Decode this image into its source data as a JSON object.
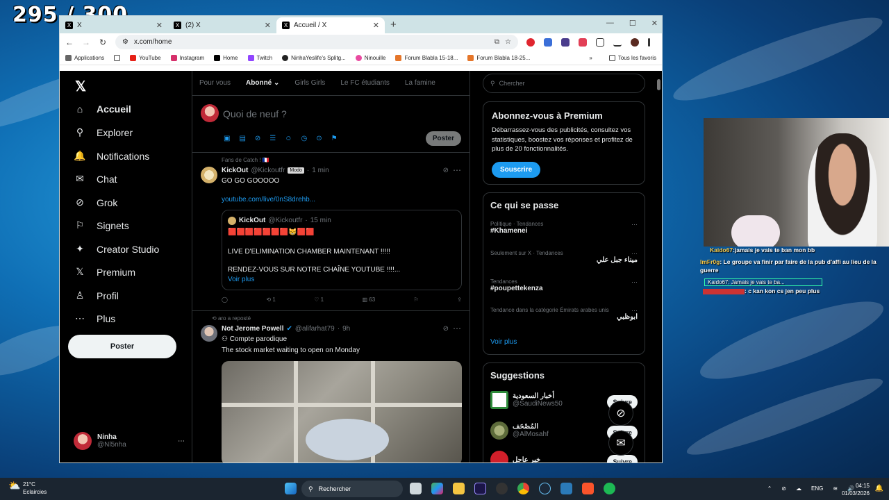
{
  "overlay": {
    "counter": "295 / 300",
    "chat": [
      {
        "name": "Kaido67",
        "text": ":jamais je vais te ban mon bb"
      },
      {
        "name": "ImFr0g",
        "text": ": Le groupe va finir par faire de la pub d'affi au lieu de la"
      },
      {
        "name": "",
        "text": "guerre"
      },
      {
        "name": "",
        "text": "Kaido67: Jamais je vais te ba..."
      },
      {
        "name": "",
        "text": ": c kan kon cs jen peu plus"
      }
    ]
  },
  "browser": {
    "tabs": [
      {
        "label": "X",
        "active": false
      },
      {
        "label": "(2) X",
        "active": false
      },
      {
        "label": "Accueil / X",
        "active": true
      }
    ],
    "url": "x.com/home",
    "bookmarks": [
      "Applications",
      "YouTube",
      "Instagram",
      "Home",
      "Twitch",
      "NinhaYeslife's Splitg...",
      "Ninouille",
      "Forum Blabla 15-18...",
      "Forum Blabla 18-25..."
    ],
    "bookmarks_more": "»",
    "all_favorites": "Tous les favoris"
  },
  "x": {
    "nav": [
      {
        "label": "Accueil",
        "icon": "home-icon",
        "glyph": "⌂"
      },
      {
        "label": "Explorer",
        "icon": "search-icon",
        "glyph": "⚲"
      },
      {
        "label": "Notifications",
        "icon": "bell-icon",
        "glyph": "🔔"
      },
      {
        "label": "Chat",
        "icon": "mail-icon",
        "glyph": "✉"
      },
      {
        "label": "Grok",
        "icon": "grok-icon",
        "glyph": "⊘"
      },
      {
        "label": "Signets",
        "icon": "bookmark-icon",
        "glyph": "⚐"
      },
      {
        "label": "Creator Studio",
        "icon": "creator-icon",
        "glyph": "✦"
      },
      {
        "label": "Premium",
        "icon": "x-icon",
        "glyph": "𝕏"
      },
      {
        "label": "Profil",
        "icon": "person-icon",
        "glyph": "♙"
      },
      {
        "label": "Plus",
        "icon": "more-icon",
        "glyph": "⋯"
      }
    ],
    "post_button": "Poster",
    "account": {
      "name": "Ninha",
      "handle": "@Nl5nha"
    },
    "timeline_tabs": [
      "Pour vous",
      "Abonné",
      "Girls Girls",
      "Le FC étudiants",
      "La famine"
    ],
    "composer": {
      "placeholder": "Quoi de neuf ?",
      "post": "Poster"
    },
    "tweet1": {
      "context": "Fans de Catch !",
      "name": "KickOut",
      "handle": "@Kickoutfr",
      "badge": "Modo",
      "time": "1 min",
      "text": "GO GO GOOOOO",
      "link": "youtube.com/live/0nS8drehb...",
      "quote": {
        "name": "KickOut",
        "handle": "@Kickoutfr",
        "time": "15 min",
        "emojis": "🟥🟥🟥🟥🟥🟥🟥😸🟥🟥",
        "line1": "LIVE D'ELIMINATION CHAMBER MAINTENANT !!!!!",
        "line2": "RENDEZ-VOUS SUR NOTRE CHAÎNE YOUTUBE !!!!...",
        "more": "Voir plus"
      },
      "retweets": "1",
      "likes": "1",
      "views": "63"
    },
    "tweet2": {
      "context": "aro a reposté",
      "name": "Not Jerome Powell",
      "handle": "@alifarhat79",
      "time": "9h",
      "label": "Compte parodique",
      "text": "The stock market waiting to open on Monday"
    },
    "search_placeholder": "Chercher",
    "premium": {
      "title": "Abonnez-vous à Premium",
      "body": "Débarrassez-vous des publicités, consultez vos statistiques, boostez vos réponses et profitez de plus de 20 fonctionnalités.",
      "button": "Souscrire"
    },
    "trends": {
      "title": "Ce qui se passe",
      "items": [
        {
          "context": "Politique · Tendances",
          "topic": "#Khamenei"
        },
        {
          "context": "Seulement sur X · Tendances",
          "topic": "ميناء جبل علي"
        },
        {
          "context": "Tendances",
          "topic": "#poupettekenza"
        },
        {
          "context": "Tendance dans la catégorie Émirats arabes unis",
          "topic": "ابوظبي"
        }
      ],
      "more": "Voir plus"
    },
    "suggestions": {
      "title": "Suggestions",
      "items": [
        {
          "name": "أخبار السعودية",
          "handle": "@SaudiNews50",
          "button": "Suivre"
        },
        {
          "name": "المُصْحَف",
          "handle": "@AlMosahf",
          "button": "Suivre"
        },
        {
          "name": "خبر عاجل",
          "handle": "",
          "button": "Suivre"
        }
      ]
    }
  },
  "taskbar": {
    "temp": "21°C",
    "weather": "Eclaircies",
    "search": "Rechercher",
    "lang": "ENG",
    "time": "04:15",
    "date": "01/03/2026"
  }
}
